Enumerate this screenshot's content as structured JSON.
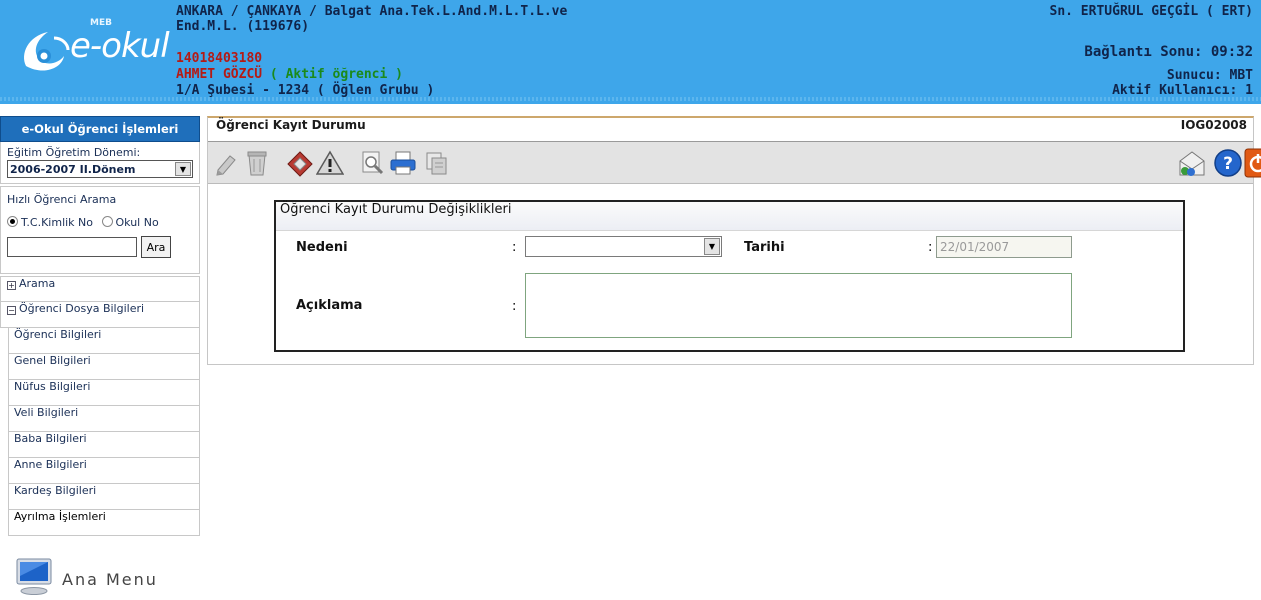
{
  "header": {
    "logo_small": "MEB",
    "logo_text": "e-okul",
    "school_line1": "ANKARA / ÇANKAYA / Balgat Ana.Tek.L.And.M.L.T.L.ve",
    "school_line2": "End.M.L. (119676)",
    "student_no": "14018403180",
    "student_name": "AHMET  GÖZCÜ",
    "student_status": "( Aktif öğrenci )",
    "class_info": "1/A Şubesi - 1234  ( Öğlen Grubu )",
    "user": "Sn. ERTUĞRUL GEÇGİL ( ERT)",
    "connection_end": "Bağlantı Sonu: 09:32",
    "server": "Sunucu: MBT",
    "active_users": "Aktif Kullanıcı: 1",
    "colors": {
      "bg": "#3ea6ea",
      "navy": "#10244a",
      "red": "#b51a14",
      "green": "#1b8a1b"
    }
  },
  "sidebar": {
    "title": "e-Okul Öğrenci İşlemleri",
    "term_label": "Eğitim Öğretim Dönemi:",
    "term_value": "2006-2007 II.Dönem",
    "quick_search_label": "Hızlı Öğrenci Arama",
    "radio_tc": "T.C.Kimlik No",
    "radio_school": "Okul No",
    "search_value": "",
    "search_button": "Ara",
    "menu_arama": "Arama",
    "menu_dosya": "Öğrenci Dosya Bilgileri",
    "sub_items": [
      {
        "label": "Öğrenci Bilgileri"
      },
      {
        "label": "Genel Bilgileri"
      },
      {
        "label": "Nüfus Bilgileri"
      },
      {
        "label": "Veli Bilgileri"
      },
      {
        "label": "Baba Bilgileri"
      },
      {
        "label": "Anne Bilgileri"
      },
      {
        "label": "Kardeş Bilgileri"
      },
      {
        "label": "Ayrılma İşlemleri"
      }
    ],
    "ana_menu": "Ana Menu"
  },
  "main": {
    "title": "Öğrenci Kayıt Durumu",
    "code": "IOG02008",
    "toolbar_icons": [
      "edit-icon",
      "delete-icon",
      "eraser-icon",
      "warning-icon",
      "preview-icon",
      "print-icon",
      "export-icon",
      "mail-icon",
      "help-icon",
      "exit-icon"
    ]
  },
  "form": {
    "legend": "Öğrenci Kayıt Durumu Değişiklikleri",
    "reason_label": "Nedeni",
    "reason_value": "",
    "date_label": "Tarihi",
    "date_value": "22/01/2007",
    "desc_label": "Açıklama",
    "desc_value": "",
    "colon": ":"
  }
}
